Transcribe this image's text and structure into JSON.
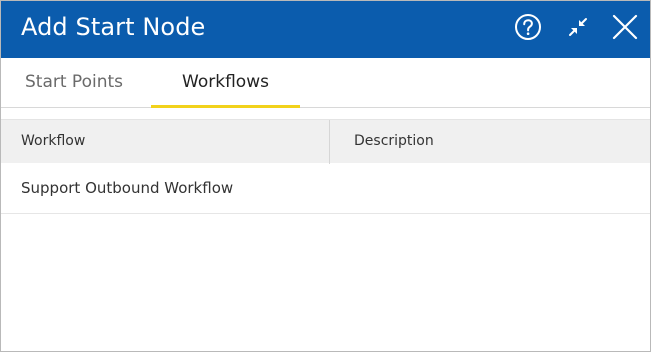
{
  "dialog": {
    "title": "Add Start Node",
    "help_icon": "help-circle-icon",
    "collapse_icon": "collapse-arrows-icon",
    "close_icon": "close-icon"
  },
  "tabs": [
    {
      "label": "Start Points",
      "active": false
    },
    {
      "label": "Workflows",
      "active": true
    }
  ],
  "table": {
    "columns": [
      "Workflow",
      "Description"
    ],
    "rows": [
      {
        "workflow": "Support Outbound Workflow",
        "description": ""
      }
    ]
  },
  "colors": {
    "titlebar": "#0b5cad",
    "active_tab_underline": "#f2d21b",
    "header_bg": "#f0f0f0"
  }
}
